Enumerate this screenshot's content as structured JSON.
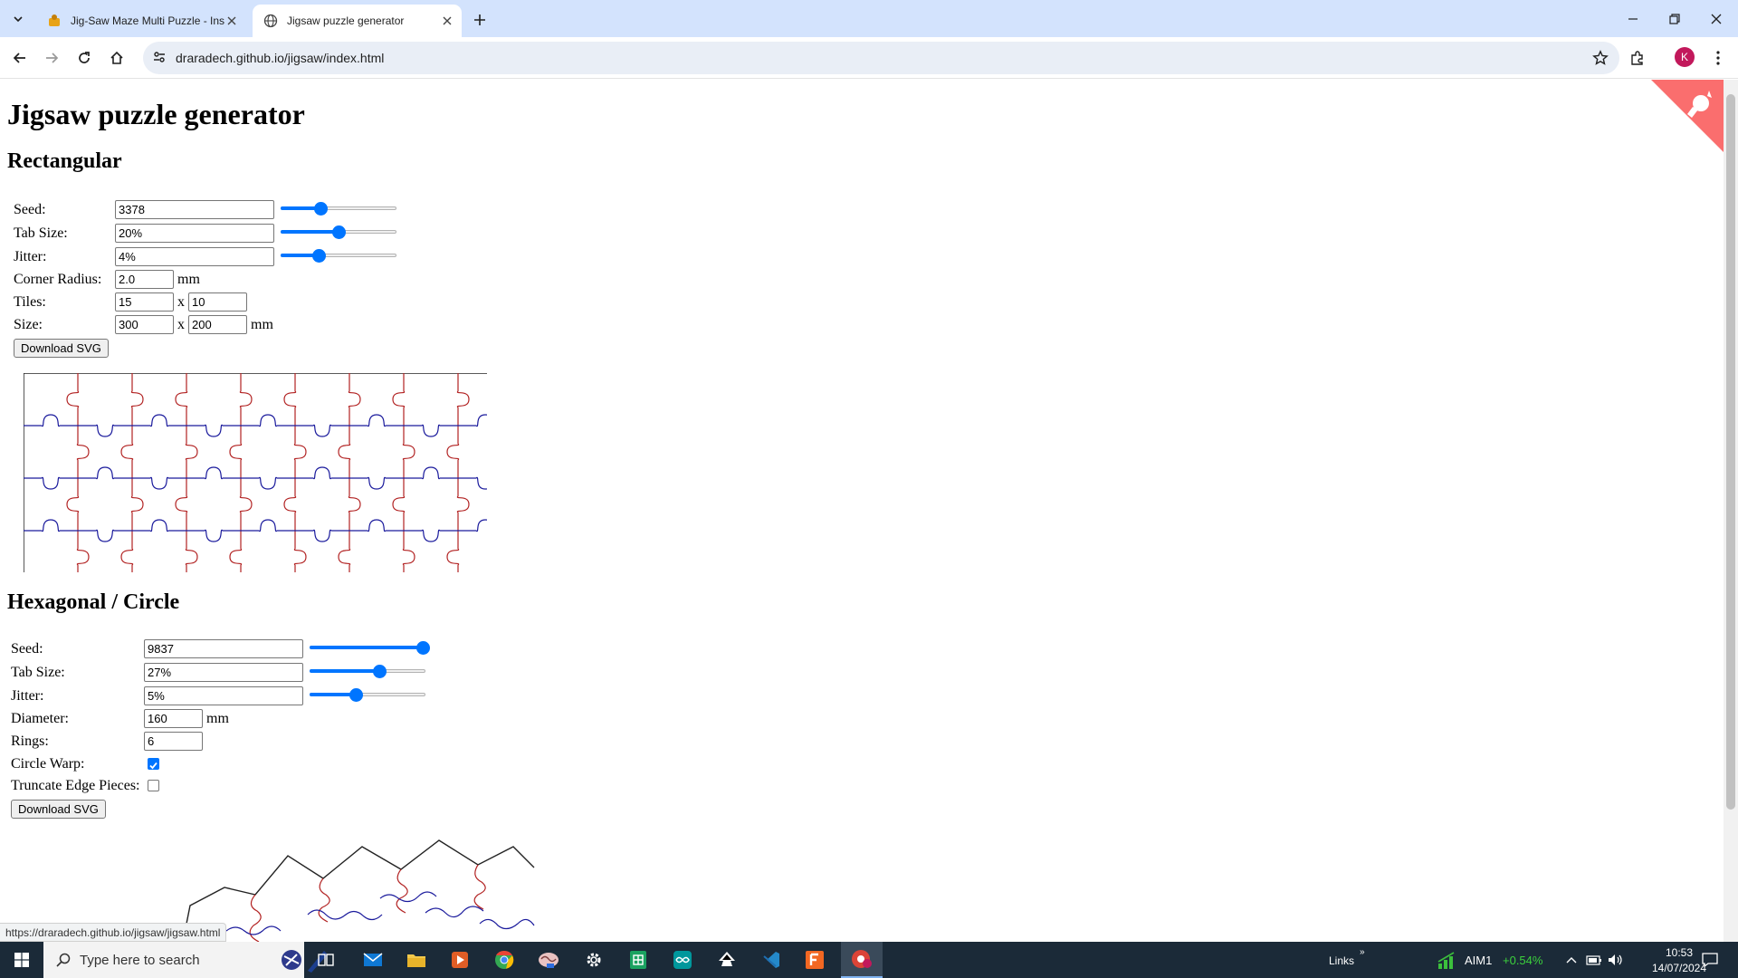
{
  "browser": {
    "tabs": [
      {
        "title": "Jig-Saw Maze Multi Puzzle - Ins",
        "active": false
      },
      {
        "title": "Jigsaw puzzle generator",
        "active": true
      }
    ],
    "url": "draradech.github.io/jigsaw/index.html",
    "profile_initial": "K",
    "status_url": "https://draradech.github.io/jigsaw/jigsaw.html"
  },
  "page": {
    "title": "Jigsaw puzzle generator",
    "rect": {
      "heading": "Rectangular",
      "seed_label": "Seed:",
      "seed": "3378",
      "seed_slider": 0.34,
      "tabsize_label": "Tab Size:",
      "tabsize": "20%",
      "tabsize_slider": 0.5,
      "jitter_label": "Jitter:",
      "jitter": "4%",
      "jitter_slider": 0.33,
      "radius_label": "Corner Radius:",
      "radius": "2.0",
      "radius_unit": "mm",
      "tiles_label": "Tiles:",
      "tiles_x": "15",
      "tiles_sep": "x",
      "tiles_y": "10",
      "size_label": "Size:",
      "size_w": "300",
      "size_sep": "x",
      "size_h": "200",
      "size_unit": "mm",
      "download": "Download SVG"
    },
    "hex": {
      "heading": "Hexagonal / Circle",
      "seed_label": "Seed:",
      "seed": "9837",
      "seed_slider": 0.98,
      "tabsize_label": "Tab Size:",
      "tabsize": "27%",
      "tabsize_slider": 0.6,
      "jitter_label": "Jitter:",
      "jitter": "5%",
      "jitter_slider": 0.4,
      "diameter_label": "Diameter:",
      "diameter": "160",
      "diameter_unit": "mm",
      "rings_label": "Rings:",
      "rings": "6",
      "warp_label": "Circle Warp:",
      "warp_checked": true,
      "truncate_label": "Truncate Edge Pieces:",
      "truncate_checked": false,
      "download": "Download SVG"
    }
  },
  "taskbar": {
    "search_placeholder": "Type here to search",
    "links_label": "Links",
    "stock_name": "AIM1",
    "stock_change": "+0.54%",
    "time": "10:53",
    "date": "14/07/2024"
  },
  "colors": {
    "accent": "#0075ff",
    "vertical_cuts": "#b22222",
    "horizontal_cuts": "#1a1a9c",
    "fork_ribbon": "#fa6e6e"
  }
}
